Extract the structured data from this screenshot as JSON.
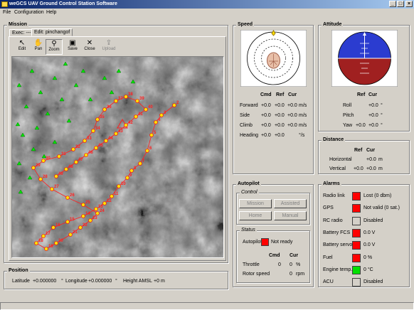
{
  "window": {
    "title": "weGCS UAV Ground Control Station Software",
    "min": "_",
    "max": "□",
    "close": "×"
  },
  "menu": [
    "File",
    "Configuration",
    "Help"
  ],
  "mission": {
    "legend": "Mission",
    "tabs": [
      "Exec: ---",
      "Edit: pinchangof"
    ],
    "tools": [
      {
        "label": "Edit",
        "icon": "arrow-pointer-icon",
        "glyph": "↖"
      },
      {
        "label": "Pan",
        "icon": "hand-icon",
        "glyph": "✋"
      },
      {
        "label": "Zoom",
        "icon": "magnifier-icon",
        "glyph": "⚲"
      },
      {
        "label": "Save",
        "icon": "floppy-disk-icon",
        "glyph": "▣"
      },
      {
        "label": "Close",
        "icon": "close-x-icon",
        "glyph": "✕"
      },
      {
        "label": "Upload",
        "icon": "upload-icon",
        "glyph": "⇪"
      }
    ],
    "waypoints": [
      "2",
      "3",
      "4",
      "5",
      "6",
      "7",
      "8",
      "9",
      "10",
      "11",
      "12",
      "13",
      "14",
      "15",
      "16",
      "17",
      "18",
      "19",
      "20",
      "21",
      "22",
      "23",
      "24",
      "25",
      "26",
      "27",
      "28",
      "29",
      "30",
      "31",
      "32",
      "33",
      "34",
      "35",
      "36",
      "37",
      "38",
      "39",
      "40",
      "41",
      "42",
      "43",
      "44",
      "45",
      "46",
      "47",
      "48",
      "49"
    ]
  },
  "position": {
    "legend": "Position",
    "lat_label": "Latitude",
    "lat": "+0.000000",
    "lat_unit": "°",
    "lon_label": "Longitude",
    "lon": "+0.000000",
    "lon_unit": "°",
    "h_label": "Height AMSL",
    "h": "+0",
    "h_unit": "m"
  },
  "speed": {
    "legend": "Speed",
    "cols": [
      "Cmd",
      "Ref",
      "Cur"
    ],
    "rows": [
      {
        "label": "Forward",
        "cmd": "+0.0",
        "ref": "+0.0",
        "cur": "+0.0",
        "unit": "m/s"
      },
      {
        "label": "Side",
        "cmd": "+0.0",
        "ref": "+0.0",
        "cur": "+0.0",
        "unit": "m/s"
      },
      {
        "label": "Climb",
        "cmd": "+0.0",
        "ref": "+0.0",
        "cur": "+0.0",
        "unit": "m/s"
      },
      {
        "label": "Heading",
        "cmd": "+0.0",
        "ref": "+0.0",
        "cur": "",
        "unit": "°/s"
      }
    ]
  },
  "attitude": {
    "legend": "Attitude",
    "cols": [
      "Ref",
      "Cur"
    ],
    "rows": [
      {
        "label": "Roll",
        "ref": "",
        "cur": "+0.0",
        "unit": "°"
      },
      {
        "label": "Pitch",
        "ref": "",
        "cur": "+0.0",
        "unit": "°"
      },
      {
        "label": "Yaw",
        "ref": "+0.0",
        "cur": "+0.0",
        "unit": "°"
      }
    ],
    "sky": "#2b3cd0",
    "ground": "#a02020"
  },
  "distance": {
    "legend": "Distance",
    "cols": [
      "Ref",
      "Cur"
    ],
    "rows": [
      {
        "label": "Horizontal",
        "ref": "",
        "cur": "+0.0",
        "unit": "m"
      },
      {
        "label": "Vertical",
        "ref": "+0.0",
        "cur": "+0.0",
        "unit": "m"
      }
    ]
  },
  "autopilot": {
    "legend": "Autopilot",
    "control_legend": "Control",
    "buttons": [
      "Mission",
      "Assisted",
      "Home",
      "Manual"
    ],
    "status_legend": "Status",
    "ap_label": "Autopilot",
    "ap_value": "Not ready",
    "cols": [
      "Cmd",
      "Cur"
    ],
    "rows": [
      {
        "label": "Throttle",
        "cmd": "0",
        "cur": "0",
        "unit": "%"
      },
      {
        "label": "Rotor speed",
        "cmd": "",
        "cur": "0",
        "unit": "rpm"
      }
    ]
  },
  "alarms": {
    "legend": "Alarms",
    "items": [
      {
        "label": "Radio link",
        "state": "red",
        "value": "Lost (0 dbm)"
      },
      {
        "label": "GPS",
        "state": "red",
        "value": "Not valid (0 sat.)"
      },
      {
        "label": "RC radio",
        "state": "grey",
        "value": "Disabled"
      },
      {
        "label": "Battery FCS",
        "state": "red",
        "value": "0.0 V"
      },
      {
        "label": "Battery servos",
        "state": "red",
        "value": "0.0 V"
      },
      {
        "label": "Fuel",
        "state": "red",
        "value": "0 %"
      },
      {
        "label": "Engine temp.",
        "state": "green",
        "value": "0 °C"
      },
      {
        "label": "ACU",
        "state": "grey",
        "value": "Disabled"
      }
    ]
  }
}
